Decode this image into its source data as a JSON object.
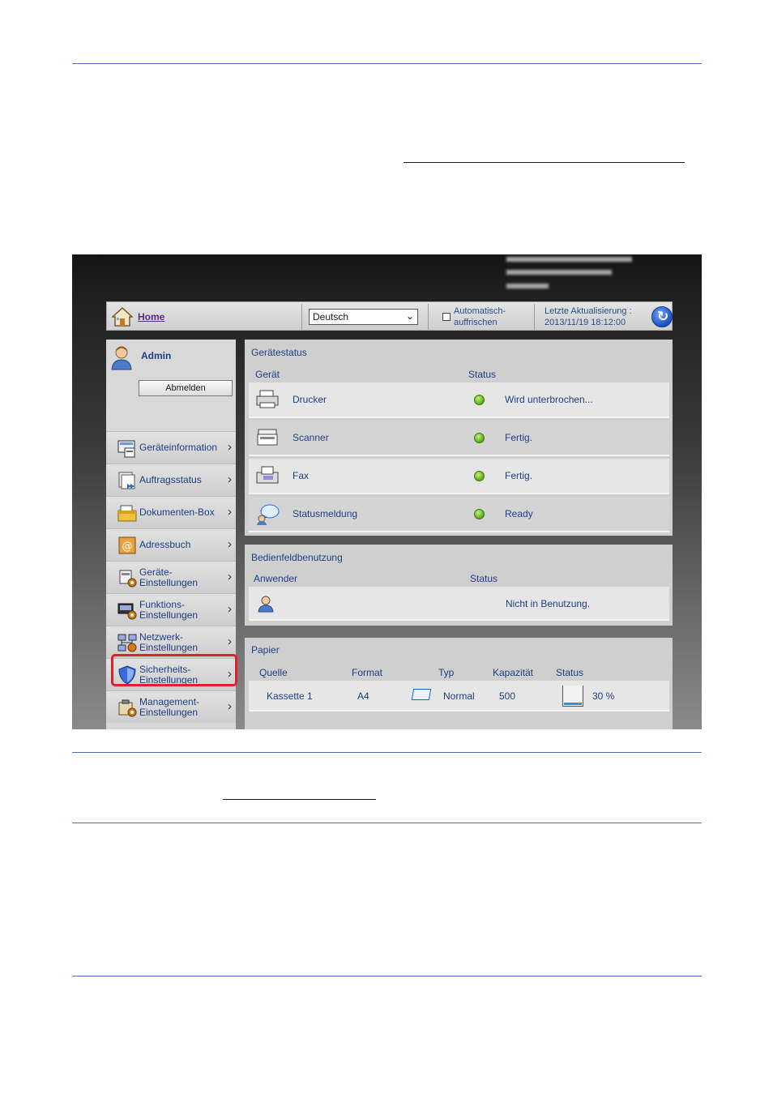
{
  "header": {
    "home_label": "Home"
  },
  "language": {
    "selected": "Deutsch"
  },
  "auto_refresh": {
    "label_line1": "Automatisch-",
    "label_line2": "auffrischen",
    "checked": false
  },
  "last_update": {
    "label": "Letzte Aktualisierung :",
    "value": "2013/11/19 18:12:00"
  },
  "user": {
    "name": "Admin",
    "logout_label": "Abmelden"
  },
  "nav": [
    {
      "line1": "Geräteinformation",
      "line2": "",
      "icon": "device-info-icon"
    },
    {
      "line1": "Auftragsstatus",
      "line2": "",
      "icon": "job-status-icon"
    },
    {
      "line1": "Dokumenten-Box",
      "line2": "",
      "icon": "document-box-icon"
    },
    {
      "line1": "Adressbuch",
      "line2": "",
      "icon": "address-book-icon"
    },
    {
      "line1": "Geräte-",
      "line2": "Einstellungen",
      "icon": "device-settings-icon"
    },
    {
      "line1": "Funktions-",
      "line2": "Einstellungen",
      "icon": "function-settings-icon"
    },
    {
      "line1": "Netzwerk-",
      "line2": "Einstellungen",
      "icon": "network-settings-icon"
    },
    {
      "line1": "Sicherheits-",
      "line2": "Einstellungen",
      "icon": "security-shield-icon",
      "highlighted": true
    },
    {
      "line1": "Management-",
      "line2": "Einstellungen",
      "icon": "management-settings-icon"
    }
  ],
  "device_status": {
    "title": "Gerätestatus",
    "col_device": "Gerät",
    "col_status": "Status",
    "rows": [
      {
        "name": "Drucker",
        "status": "Wird unterbrochen...",
        "icon": "printer-icon"
      },
      {
        "name": "Scanner",
        "status": "Fertig.",
        "icon": "scanner-icon"
      },
      {
        "name": "Fax",
        "status": "Fertig.",
        "icon": "fax-icon"
      },
      {
        "name": "Statusmeldung",
        "status": "Ready",
        "icon": "status-message-icon"
      }
    ]
  },
  "panel_usage": {
    "title": "Bedienfeldbenutzung",
    "col_user": "Anwender",
    "col_status": "Status",
    "status": "Nicht in Benutzung."
  },
  "paper": {
    "title": "Papier",
    "cols": {
      "source": "Quelle",
      "format": "Format",
      "type": "Typ",
      "capacity": "Kapazität",
      "status": "Status"
    },
    "rows": [
      {
        "source": "Kassette 1",
        "format": "A4",
        "type": "Normal",
        "capacity": "500",
        "status": "30 %",
        "level": 0.3
      }
    ]
  },
  "colors": {
    "rule": "#4a6fb5",
    "link": "#1e3e86",
    "highlight": "#e0202a"
  }
}
